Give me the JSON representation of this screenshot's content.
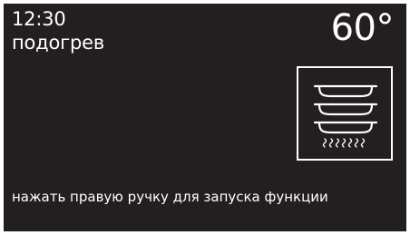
{
  "status": {
    "time": "12:30",
    "mode_label": "подогрев"
  },
  "temperature": {
    "value": "60°"
  },
  "function": {
    "icon": "plate-warming-icon"
  },
  "instruction": {
    "text": "нажать правую ручку для запуска функции"
  },
  "colors": {
    "screen_background": "#231f20",
    "foreground": "#ffffff"
  }
}
